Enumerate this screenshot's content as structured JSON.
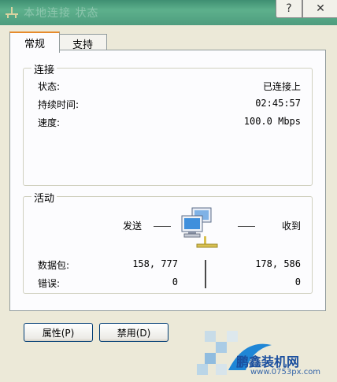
{
  "window": {
    "title": "本地连接 状态",
    "help_label": "?",
    "close_label": "✕"
  },
  "tabs": [
    {
      "label": "常规"
    },
    {
      "label": "支持"
    }
  ],
  "connection": {
    "title": "连接",
    "rows": [
      {
        "label": "状态:",
        "value": "已连接上"
      },
      {
        "label": "持续时间:",
        "value": "02:45:57"
      },
      {
        "label": "速度:",
        "value": "100.0 Mbps"
      }
    ]
  },
  "activity": {
    "title": "活动",
    "sent_label": "发送",
    "received_label": "收到",
    "packets_label": "数据包:",
    "packets_sent": "158, 777",
    "packets_received": "178, 586",
    "errors_label": "错误:",
    "errors_sent": "0",
    "errors_received": "0"
  },
  "buttons": {
    "properties": "属性(P)",
    "disable": "禁用(D)"
  },
  "watermark": {
    "brand": "鹏鑫装机网",
    "url": "www.0753px.com"
  },
  "colors": {
    "title_bar": "#4E9C7E",
    "tab_accent": "#E68B2C",
    "button_border": "#003C74",
    "watermark_blue": "#1A4E9E"
  }
}
